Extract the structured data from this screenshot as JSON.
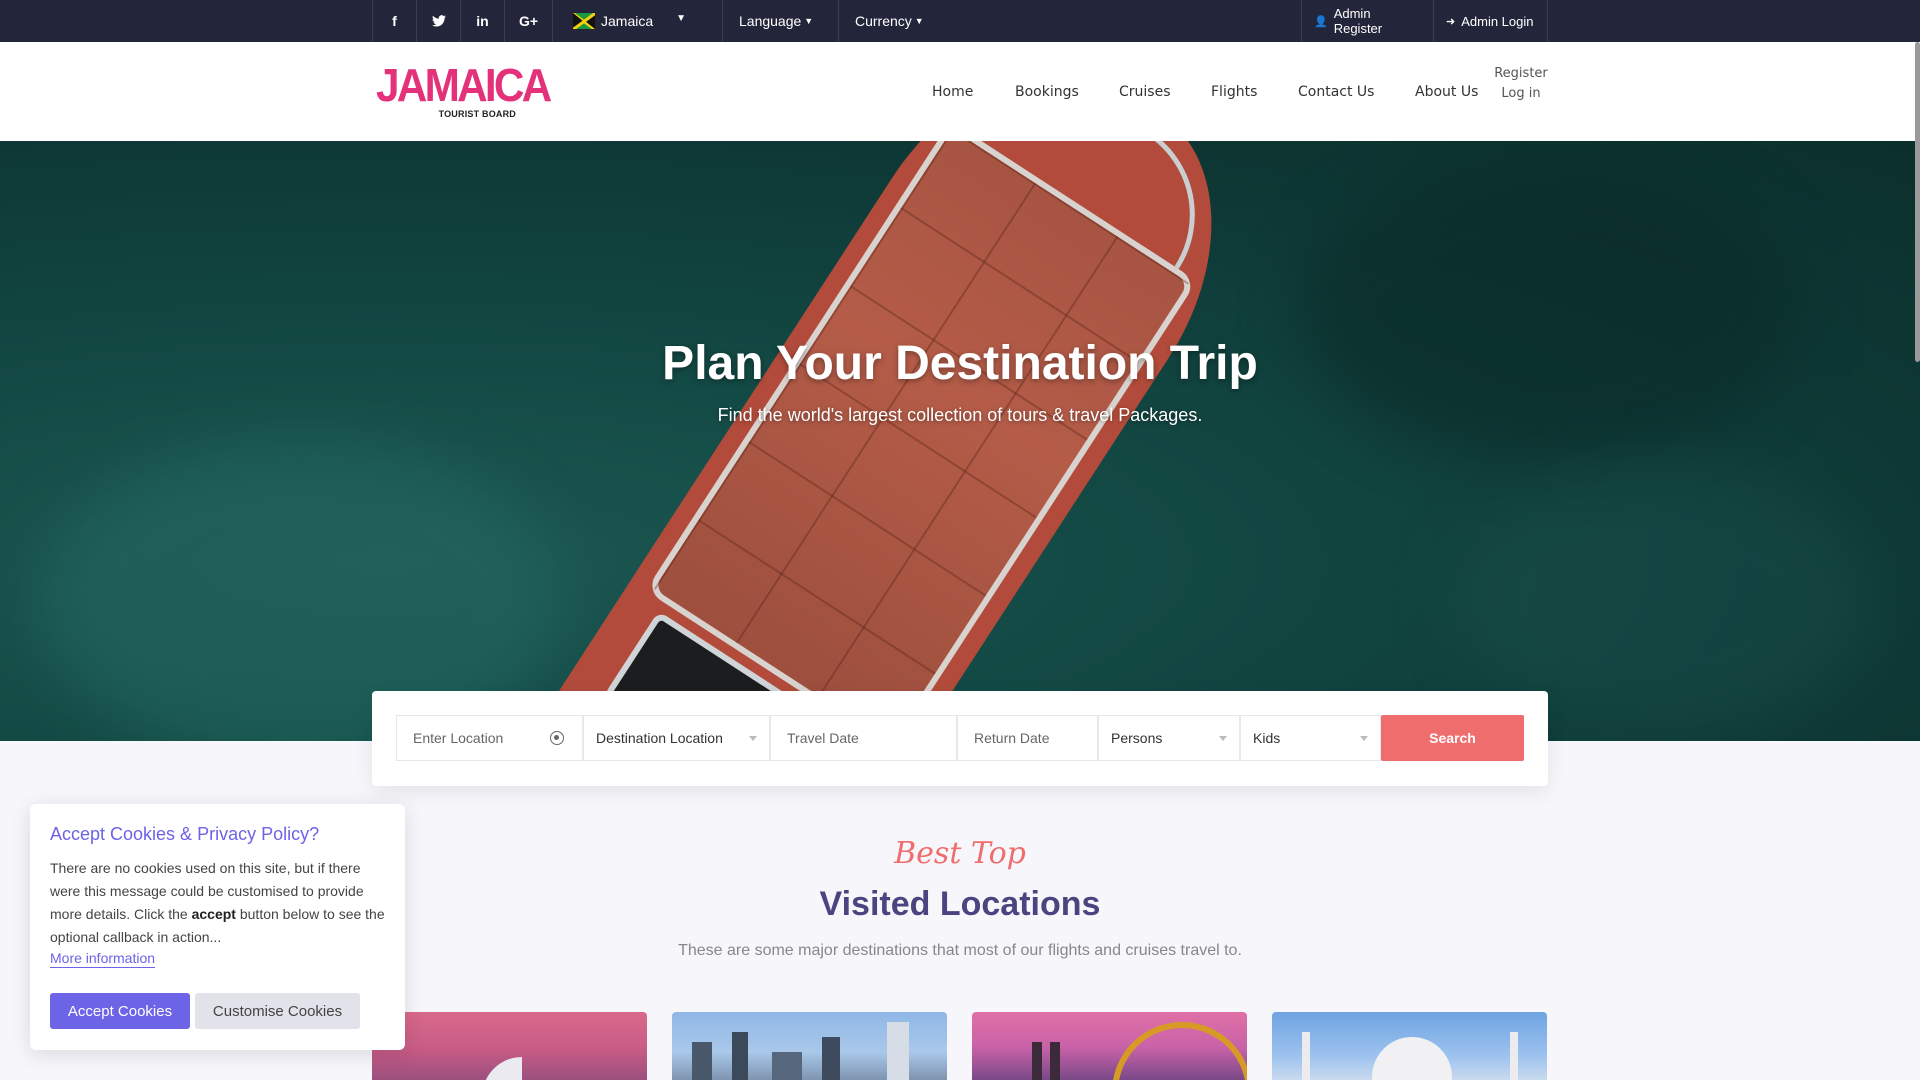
{
  "topbar": {
    "social": [
      {
        "name": "facebook-icon",
        "glyph": "f"
      },
      {
        "name": "twitter-icon",
        "glyph": "🐦"
      },
      {
        "name": "linkedin-icon",
        "glyph": "in"
      },
      {
        "name": "google-plus-icon",
        "glyph": "G+"
      }
    ],
    "country": "Jamaica",
    "language": "Language",
    "currency": "Currency",
    "admin_register": "Admin Register",
    "admin_login": "Admin Login"
  },
  "header": {
    "logo_main": "JAMAICA",
    "logo_sub": "TOURIST BOARD",
    "nav": [
      "Home",
      "Bookings",
      "Cruises",
      "Flights",
      "Contact Us",
      "About Us"
    ],
    "register": "Register",
    "login": "Log in"
  },
  "hero": {
    "title": "Plan Your Destination Trip",
    "subtitle": "Find the world's largest collection of tours & travel Packages."
  },
  "search": {
    "location_placeholder": "Enter Location",
    "destination": "Destination Location",
    "travel_date": "Travel Date",
    "return_date": "Return Date",
    "persons": "Persons",
    "kids": "Kids",
    "button": "Search"
  },
  "section": {
    "script": "Best Top",
    "title": "Visited Locations",
    "subtitle": "These are some major destinations that most of our flights and cruises travel to."
  },
  "cookie": {
    "title": "Accept Cookies & Privacy Policy?",
    "text_before": "There are no cookies used on this site, but if there were this message could be customised to provide more details. Click the ",
    "text_bold": "accept",
    "text_after": " button below to see the optional callback in action...",
    "more": "More information",
    "accept": "Accept Cookies",
    "customise": "Customise Cookies"
  },
  "colors": {
    "topbar": "#23263b",
    "brand_pink": "#e4327a",
    "accent_coral": "#f06d6d",
    "accent_purple": "#6c63e6",
    "title_purple": "#4a4580"
  }
}
